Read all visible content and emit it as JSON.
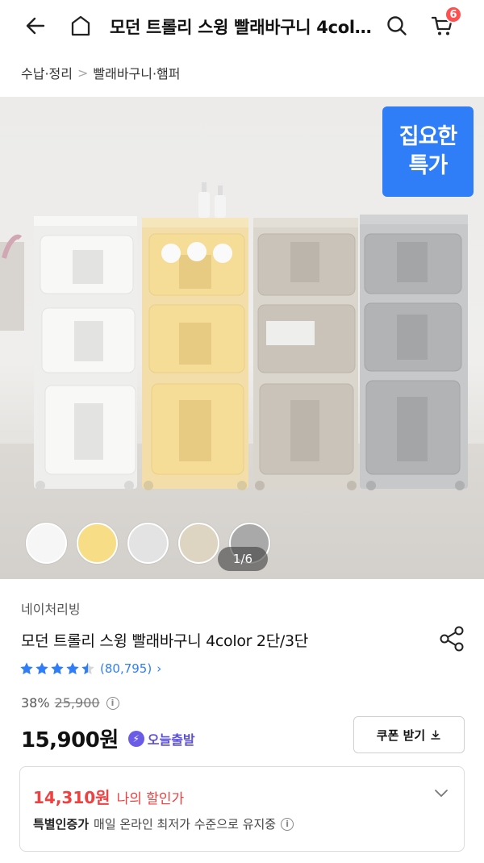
{
  "header": {
    "title": "모던 트롤리 스윙 빨래바구니 4colo...",
    "cart_count": "6"
  },
  "breadcrumb": {
    "items": [
      "수납·정리",
      "빨래바구니·햄퍼"
    ],
    "separator": ">"
  },
  "hero": {
    "promo_badge_line1": "집요한",
    "promo_badge_line2": "특가",
    "promo_badge_color": "#2f7ef7",
    "page_counter": "1/6",
    "swatch_colors": [
      "#f6f6f6",
      "#f6dd86",
      "#e3e3e3",
      "#ddd5c2",
      "#a9a9a9"
    ]
  },
  "product": {
    "brand": "네이처리빙",
    "title": "모던 트롤리 스윙 빨래바구니 4color 2단/3단",
    "rating": 4.5,
    "review_count": "(80,795)",
    "discount_rate": "38%",
    "original_price": "25,900",
    "sale_price": "15,900원",
    "delivery_label": "오늘출발"
  },
  "coupon": {
    "label": "쿠폰 받기"
  },
  "my_deal": {
    "price": "14,310원",
    "label": "나의 할인가",
    "sub_strong": "특별인증가",
    "sub_text": "매일 온라인 최저가 수준으로 유지중"
  }
}
